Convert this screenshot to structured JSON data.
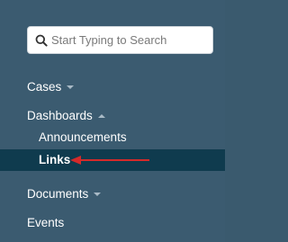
{
  "search": {
    "placeholder": "Start Typing to Search"
  },
  "nav": {
    "cases_label": "Cases",
    "dashboards_label": "Dashboards",
    "dashboards_children": {
      "announcements_label": "Announcements",
      "links_label": "Links"
    },
    "documents_label": "Documents",
    "events_label": "Events"
  },
  "colors": {
    "sidebar_bg": "#3b5b70",
    "active_bg": "#0f3b4e",
    "arrow": "#d42a2a"
  },
  "icons": {
    "search": "search-icon",
    "annotation_arrow": "red-arrow-icon"
  }
}
